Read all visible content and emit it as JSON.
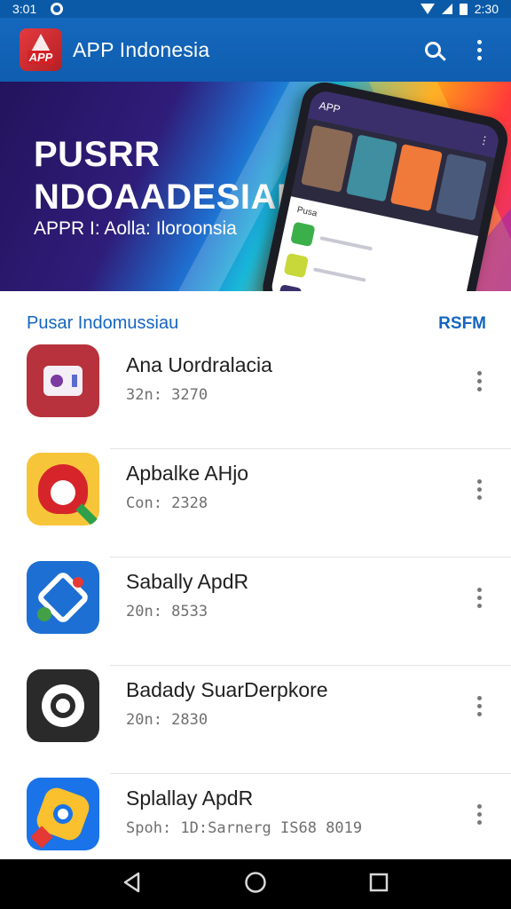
{
  "status_bar": {
    "time_left": "3:01",
    "time_right": "2:30"
  },
  "app_bar": {
    "logo_text": "APP",
    "title": "APP Indonesia",
    "search_icon": "search-icon",
    "menu_icon": "more-vert-icon"
  },
  "banner": {
    "title_line1": "PUSRR",
    "title_line2": "NDOAADESIAII",
    "subtitle": "APPR I: Aolla: Iloroonsia",
    "phone_header": "APP",
    "phone_list_title": "Pusa"
  },
  "section": {
    "title": "Pusar Indomussiau",
    "action": "RSFM"
  },
  "apps": [
    {
      "name": "Ana Uordralacia",
      "sub": "32n: 3270",
      "icon": "camera-app-icon"
    },
    {
      "name": "Apbalke AHjo",
      "sub": "Con: 2328",
      "icon": "map-pin-app-icon"
    },
    {
      "name": "Sabally ApdR",
      "sub": "20n: 8533",
      "icon": "navigation-app-icon"
    },
    {
      "name": "Badady SuarDerpkore",
      "sub": "20n: 2830",
      "icon": "ring-app-icon"
    },
    {
      "name": "Splallay ApdR",
      "sub": "Spoh: 1D:Sarnerg IS68 8019",
      "icon": "gear-app-icon"
    }
  ],
  "nav": {
    "back": "back-icon",
    "home": "home-icon",
    "recents": "recents-icon"
  },
  "colors": {
    "primary": "#1468bd",
    "accent": "#1565c0",
    "nav": "#000000"
  }
}
